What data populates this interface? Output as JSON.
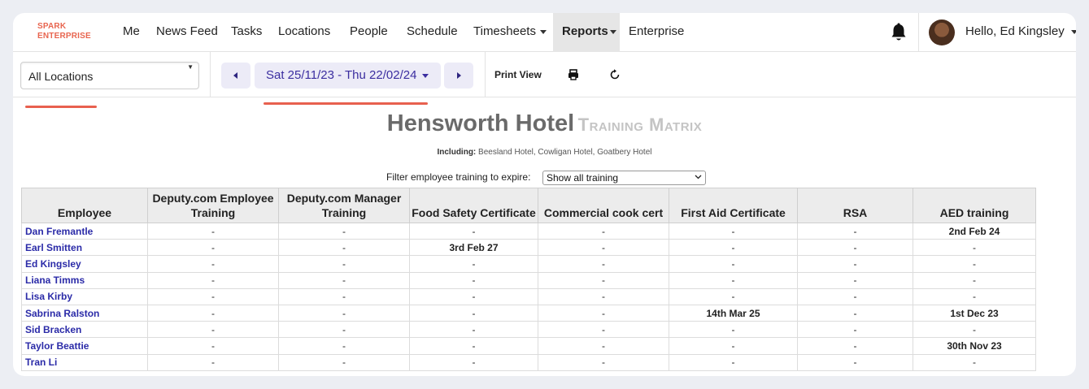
{
  "brand": {
    "line1": "SPARK",
    "line2": "ENTERPRISE"
  },
  "nav": {
    "items": [
      "Me",
      "News Feed",
      "Tasks",
      "Locations",
      "People",
      "Schedule",
      "Timesheets",
      "Reports",
      "Enterprise"
    ],
    "active": "Reports"
  },
  "user": {
    "greeting": "Hello, Ed Kingsley"
  },
  "toolbar": {
    "location": "All Locations",
    "date_range": "Sat 25/11/23 - Thu 22/02/24",
    "print_view": "Print View"
  },
  "report": {
    "hotel": "Hensworth Hotel",
    "title": "Training Matrix",
    "including_label": "Including:",
    "including_value": " Beesland Hotel, Cowligan Hotel, Goatbery Hotel"
  },
  "filter": {
    "label": "Filter employee training to expire:",
    "selected": "Show all training"
  },
  "table": {
    "headers": [
      "Employee",
      "Deputy.com Employee Training",
      "Deputy.com Manager Training",
      "Food Safety Certificate",
      "Commercial cook cert",
      "First Aid Certificate",
      "RSA",
      "AED training"
    ],
    "rows": [
      [
        "Dan Fremantle",
        "-",
        "-",
        "-",
        "-",
        "-",
        "-",
        "2nd Feb 24"
      ],
      [
        "Earl Smitten",
        "-",
        "-",
        "3rd Feb 27",
        "-",
        "-",
        "-",
        "-"
      ],
      [
        "Ed Kingsley",
        "-",
        "-",
        "-",
        "-",
        "-",
        "-",
        "-"
      ],
      [
        "Liana Timms",
        "-",
        "-",
        "-",
        "-",
        "-",
        "-",
        "-"
      ],
      [
        "Lisa Kirby",
        "-",
        "-",
        "-",
        "-",
        "-",
        "-",
        "-"
      ],
      [
        "Sabrina Ralston",
        "-",
        "-",
        "-",
        "-",
        "14th Mar 25",
        "-",
        "1st Dec 23"
      ],
      [
        "Sid Bracken",
        "-",
        "-",
        "-",
        "-",
        "-",
        "-",
        "-"
      ],
      [
        "Taylor Beattie",
        "-",
        "-",
        "-",
        "-",
        "-",
        "-",
        "30th Nov 23"
      ],
      [
        "Tran Li",
        "-",
        "-",
        "-",
        "-",
        "-",
        "-",
        "-"
      ]
    ]
  },
  "colors": {
    "accent": "#3b2ea0",
    "brand": "#e8654f",
    "highlight_underline": "#e8604f",
    "link": "#2b2ba8"
  }
}
